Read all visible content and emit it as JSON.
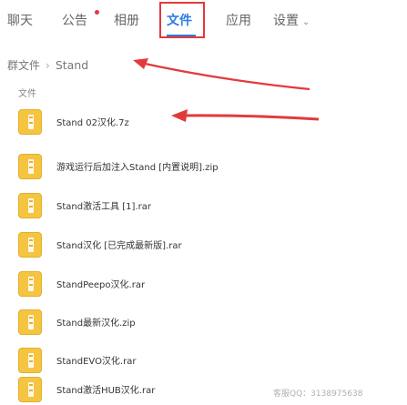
{
  "tabs": [
    {
      "label": "聊天"
    },
    {
      "label": "公告"
    },
    {
      "label": "相册"
    },
    {
      "label": "文件"
    },
    {
      "label": "应用"
    },
    {
      "label": "设置"
    }
  ],
  "breadcrumb": {
    "root": "群文件",
    "separator": "›",
    "current": "Stand"
  },
  "column_header": "文件",
  "files": [
    {
      "name": "Stand 02汉化.7z"
    },
    {
      "name": "游戏运行后加注入Stand [内置说明].zip"
    },
    {
      "name": "Stand激活工具 [1].rar"
    },
    {
      "name": "Stand汉化 [已完成最新版].rar"
    },
    {
      "name": "StandPeepo汉化.rar"
    },
    {
      "name": "Stand最新汉化.zip"
    },
    {
      "name": "StandEVO汉化.rar"
    },
    {
      "name": "Stand激活HUB汉化.rar"
    }
  ],
  "watermark": "客服QQ：3138975638",
  "colors": {
    "active_tab": "#2c7be5",
    "highlight_box": "#e23a3a",
    "file_icon": "#f5c542"
  }
}
